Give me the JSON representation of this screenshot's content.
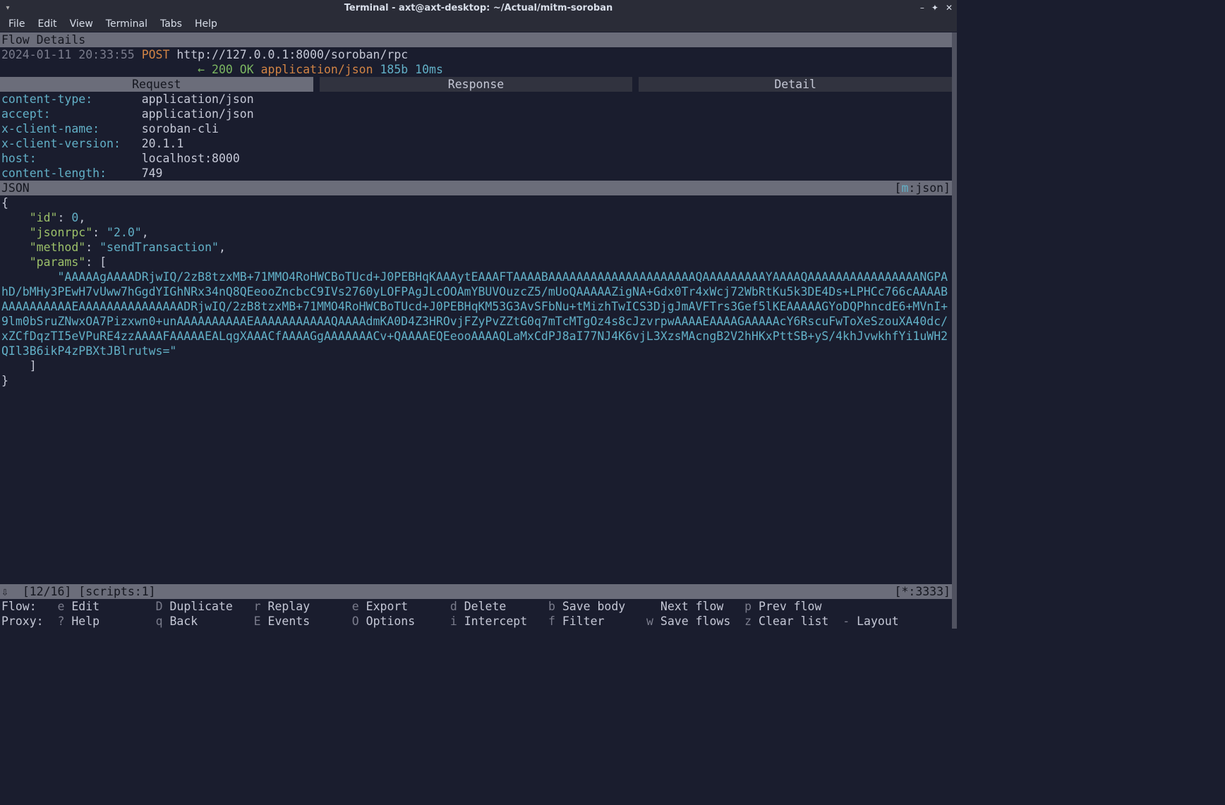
{
  "window": {
    "title": "Terminal - axt@axt-desktop: ~/Actual/mitm-soroban"
  },
  "menubar": [
    "File",
    "Edit",
    "View",
    "Terminal",
    "Tabs",
    "Help"
  ],
  "flow_details_header": "Flow Details",
  "request_line": {
    "timestamp": "2024-01-11 20:33:55",
    "method": "POST",
    "url": "http://127.0.0.1:8000/soroban/rpc"
  },
  "response_line": {
    "arrow": "←",
    "status_code": "200",
    "status_text": "OK",
    "content_type": "application/json",
    "size": "185b",
    "time": "10ms"
  },
  "tabs": {
    "request": "Request",
    "response": "Response",
    "detail": "Detail"
  },
  "headers": [
    {
      "key": "content-type:",
      "value": "application/json"
    },
    {
      "key": "accept:",
      "value": "application/json"
    },
    {
      "key": "x-client-name:",
      "value": "soroban-cli"
    },
    {
      "key": "x-client-version:",
      "value": "20.1.1"
    },
    {
      "key": "host:",
      "value": "localhost:8000"
    },
    {
      "key": "content-length:",
      "value": "749"
    }
  ],
  "json_label": "JSON",
  "json_mode": {
    "bracket_open": "[",
    "mkey": "m",
    "rest": ":json]"
  },
  "json_body": {
    "open": "{",
    "id_key": "\"id\"",
    "id_val": "0",
    "id_comma": ",",
    "jsonrpc_key": "\"jsonrpc\"",
    "jsonrpc_val": "\"2.0\"",
    "jsonrpc_comma": ",",
    "method_key": "\"method\"",
    "method_val": "\"sendTransaction\"",
    "method_comma": ",",
    "params_key": "\"params\"",
    "params_open": "[",
    "params_str": "\"AAAAAgAAAADRjwIQ/2zB8tzxMB+71MMO4RoHWCBoTUcd+J0PEBHqKAAAytEAAAFTAAAABAAAAAAAAAAAAAAAAAAAAAQAAAAAAAAAYAAAAQAAAAAAAAAAAAAAAANGPAhD/bMHy3PEwH7vUww7hGgdYIGhNRx34nQ8QEeooZncbcC9IVs2760yLOFPAgJLcOOAmYBUVOuzcZ5/mUoQAAAAAZigNA+Gdx0Tr4xWcj72WbRtKu5k3DE4Ds+LPHCc766cAAAABAAAAAAAAAAEAAAAAAAAAAAAAAADRjwIQ/2zB8tzxMB+71MMO4RoHWCBoTUcd+J0PEBHqKM53G3AvSFbNu+tMizhTwICS3DjgJmAVFTrs3Gef5lKEAAAAAGYoDQPhncdE6+MVnI+9lm0bSruZNwxOA7Pizxwn0+unAAAAAAAAAAEAAAAAAAAAAAQAAAAdmKA0D4Z3HROvjFZyPvZZtG0q7mTcMTgOz4s8cJzvrpwAAAAEAAAAGAAAAAcY6RscuFwToXeSzouXA40dc/xZCfDqzTI5eVPuRE4zzAAAAFAAAAAEALqgXAAACfAAAAGgAAAAAAACv+QAAAAEQEeooAAAAQLaMxCdPJ8aI77NJ4K6vjL3XzsMAcngB2V2hHKxPttSB+yS/4khJvwkhfYi1uWH2QIl3B6ikP4zPBXtJBlrutws=\"",
    "params_close": "]",
    "close": "}"
  },
  "statusbar": {
    "arrow": "⇩",
    "position": "[12/16]",
    "scripts": "[scripts:1]",
    "listen": "[*:3333]"
  },
  "commands": {
    "row1_label": "Flow:",
    "row2_label": "Proxy:",
    "row1": [
      {
        "key": "e",
        "label": "Edit"
      },
      {
        "key": "D",
        "label": "Duplicate"
      },
      {
        "key": "r",
        "label": "Replay"
      },
      {
        "key": "e",
        "label": "Export"
      },
      {
        "key": "d",
        "label": "Delete"
      },
      {
        "key": "b",
        "label": "Save body"
      },
      {
        "key": " ",
        "label": "Next flow"
      },
      {
        "key": "p",
        "label": "Prev flow"
      }
    ],
    "row2": [
      {
        "key": "?",
        "label": "Help"
      },
      {
        "key": "q",
        "label": "Back"
      },
      {
        "key": "E",
        "label": "Events"
      },
      {
        "key": "O",
        "label": "Options"
      },
      {
        "key": "i",
        "label": "Intercept"
      },
      {
        "key": "f",
        "label": "Filter"
      },
      {
        "key": "w",
        "label": "Save flows"
      },
      {
        "key": "z",
        "label": "Clear list"
      },
      {
        "key": "-",
        "label": "Layout"
      }
    ]
  }
}
